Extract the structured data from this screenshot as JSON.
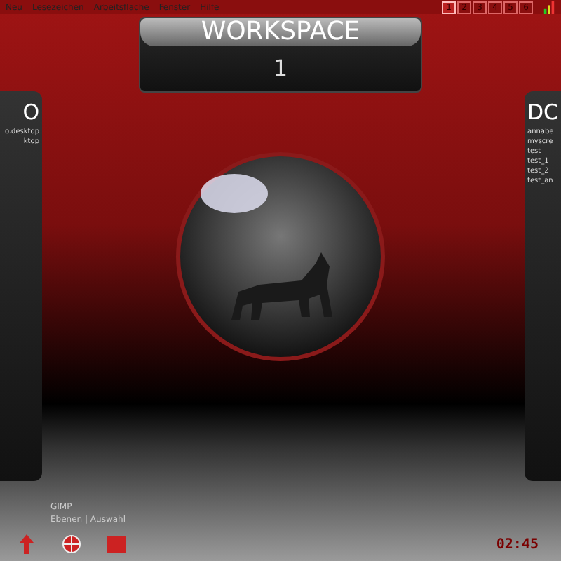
{
  "menu_bar": {
    "items": [
      "Neu",
      "Lesezeichen",
      "Arbeitsfläche",
      "Fenster",
      "Hilfe"
    ],
    "pager": [
      {
        "label": "1",
        "selected": true
      },
      {
        "label": "2",
        "selected": false
      },
      {
        "label": "3",
        "selected": false
      },
      {
        "label": "4",
        "selected": false
      },
      {
        "label": "5",
        "selected": false
      },
      {
        "label": "6",
        "selected": false
      }
    ]
  },
  "workspace_panel": {
    "title": "WORKSPACE",
    "number": "1"
  },
  "left_panel": {
    "title": "O",
    "items": [
      "o.desktop",
      "ktop"
    ]
  },
  "right_panel": {
    "title": "DC",
    "items": [
      "annabe",
      "myscre",
      "test",
      "test_1",
      "test_2",
      "test_an"
    ]
  },
  "taskbar": {
    "tasks": [
      "GIMP",
      "Ebenen | Auswahl"
    ],
    "clock": "02:45"
  }
}
